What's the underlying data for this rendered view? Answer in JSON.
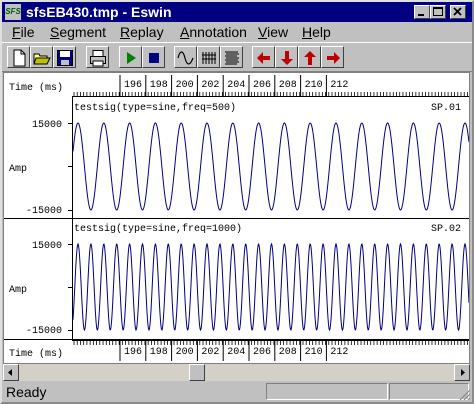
{
  "window": {
    "title": "sfsEB430.tmp - Eswin",
    "icon_label": "SFS",
    "buttons": [
      "minimize-icon",
      "maximize-icon",
      "close-icon"
    ]
  },
  "menu": [
    {
      "key": "file",
      "label": "File",
      "underline": "F",
      "rest": "ile"
    },
    {
      "key": "segment",
      "label": "Segment",
      "underline": "S",
      "rest": "egment"
    },
    {
      "key": "replay",
      "label": "Replay",
      "underline": "R",
      "rest": "eplay"
    },
    {
      "key": "annotation",
      "label": "Annotation",
      "underline": "A",
      "rest": "nnotation"
    },
    {
      "key": "view",
      "label": "View",
      "underline": "V",
      "rest": "iew"
    },
    {
      "key": "help",
      "label": "Help",
      "underline": "H",
      "rest": "elp"
    }
  ],
  "toolbar": [
    {
      "name": "new-document-icon"
    },
    {
      "name": "open-folder-icon"
    },
    {
      "name": "save-disk-icon"
    },
    {
      "name": "print-icon"
    },
    {
      "name": "play-icon",
      "color": "#008000"
    },
    {
      "name": "stop-icon",
      "color": "#000080"
    },
    {
      "name": "waveform-icon"
    },
    {
      "name": "spectrogram-icon"
    },
    {
      "name": "spectrum-lines-icon"
    },
    {
      "name": "arrow-left-icon",
      "color": "#c00000"
    },
    {
      "name": "arrow-down-icon",
      "color": "#c00000"
    },
    {
      "name": "arrow-up-icon",
      "color": "#c00000"
    },
    {
      "name": "arrow-right-icon",
      "color": "#c00000"
    }
  ],
  "time_axis": {
    "label": "Time (ms)",
    "ticks": [
      "196",
      "198",
      "200",
      "202",
      "204",
      "206",
      "208",
      "210",
      "212"
    ]
  },
  "panels": [
    {
      "key": "sp01",
      "caption": "testsig(type=sine,freq=500)",
      "id": "SP.01",
      "y_label": "Amp",
      "y_top": "15000",
      "y_bottom": "-15000",
      "frequency_hz": 500
    },
    {
      "key": "sp02",
      "caption": "testsig(type=sine,freq=1000)",
      "id": "SP.02",
      "y_label": "Amp",
      "y_top": "15000",
      "y_bottom": "-15000",
      "frequency_hz": 1000
    }
  ],
  "status": {
    "text": "Ready"
  },
  "colors": {
    "titlebar": "#000080",
    "trace": "#000080",
    "face": "#c0c0c0"
  }
}
